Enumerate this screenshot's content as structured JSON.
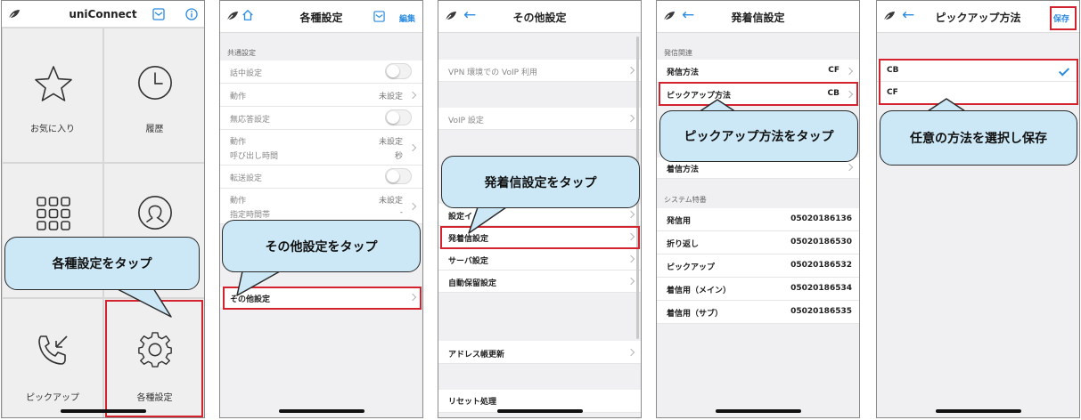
{
  "screen1": {
    "title": "uniConnect",
    "tiles": {
      "favorites": "お気に入り",
      "history": "履歴",
      "pickup": "ピックアップ",
      "settings": "各種設定"
    },
    "callout": "各種設定をタップ"
  },
  "screen2": {
    "title": "各種設定",
    "edit": "編集",
    "section": "共通設定",
    "call_busy": "話中設定",
    "action1": "動作",
    "action1_value": "未設定",
    "no_answer": "無応答設定",
    "action2": "動作",
    "action2_value": "未設定",
    "ring_time": "呼び出し時間",
    "ring_unit": "秒",
    "transfer": "転送設定",
    "action3": "動作",
    "action3_value": "未設定",
    "time_zone": "指定時間帯",
    "time_zone_value": "-",
    "callout": "その他設定をタップ",
    "other": "その他設定"
  },
  "screen3": {
    "title": "その他設定",
    "vpn": "VPN 環境での VoIP 利用",
    "voip": "VoIP 設定",
    "setting_partial": "設定イ",
    "callout": "発着信設定をタップ",
    "call": "発着信設定",
    "server": "サーバ設定",
    "auto_hold": "自動保留設定",
    "address": "アドレス帳更新",
    "reset": "リセット処理"
  },
  "screen4": {
    "title": "発着信設定",
    "section1": "発信関連",
    "out_method": "発信方法",
    "out_method_value": "CF",
    "pickup_method": "ピックアップ方法",
    "pickup_value": "CB",
    "callout": "ピックアップ方法をタップ",
    "in_method": "着信方法",
    "section2": "システム特番",
    "sys": [
      {
        "label": "発信用",
        "value": "05020186136"
      },
      {
        "label": "折り返し",
        "value": "05020186530"
      },
      {
        "label": "ピックアップ",
        "value": "05020186532"
      },
      {
        "label": "着信用（メイン）",
        "value": "05020186534"
      },
      {
        "label": "着信用（サブ）",
        "value": "05020186535"
      }
    ]
  },
  "screen5": {
    "title": "ピックアップ方法",
    "save": "保存",
    "opt_cb": "CB",
    "opt_cf": "CF",
    "callout": "任意の方法を選択し保存"
  },
  "colors": {
    "accent": "#2a8be0",
    "highlight": "#d3232e",
    "callout": "#cce8f6"
  }
}
